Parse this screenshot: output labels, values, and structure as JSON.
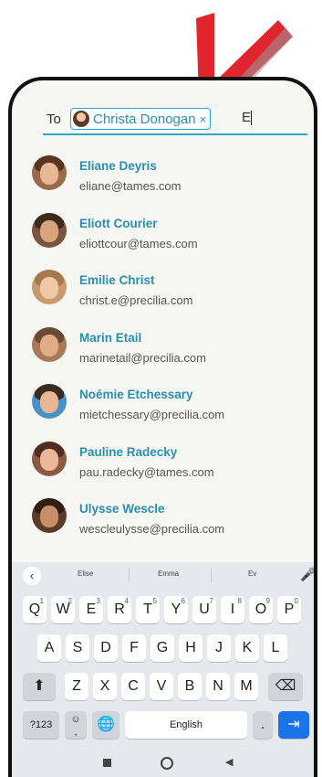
{
  "compose": {
    "to_label": "To",
    "recipient_chip": "Christa Donogan",
    "chip_close": "×",
    "input_value": "E"
  },
  "contacts": [
    {
      "name": "Eliane Deyris",
      "email": "eliane@tames.com"
    },
    {
      "name": "Eliott Courier",
      "email": "eliottcour@tames.com"
    },
    {
      "name": "Emilie Christ",
      "email": "christ.e@precilia.com"
    },
    {
      "name": "Marin Etail",
      "email": "marinetail@precilia.com"
    },
    {
      "name": "Noémie Etchessary",
      "email": "mietchessary@precilia.com"
    },
    {
      "name": "Pauline Radecky",
      "email": "pau.radecky@tames.com"
    },
    {
      "name": "Ulysse Wescle",
      "email": "wescleulysse@precilia.com"
    }
  ],
  "keyboard": {
    "suggestions": [
      "Elise",
      "Emma",
      "Ev"
    ],
    "row1": [
      "Q",
      "W",
      "E",
      "R",
      "T",
      "Y",
      "U",
      "I",
      "O",
      "P"
    ],
    "row1_digits": [
      "1",
      "2",
      "3",
      "4",
      "5",
      "6",
      "7",
      "8",
      "9",
      "0"
    ],
    "row2": [
      "A",
      "S",
      "D",
      "F",
      "G",
      "H",
      "J",
      "K",
      "L"
    ],
    "row3": [
      "Z",
      "X",
      "C",
      "V",
      "B",
      "N",
      "M"
    ],
    "symbols_key": "?123",
    "space_label": "English",
    "period_key": ".",
    "emoji_key": "☺",
    "comma_key": ","
  },
  "colors": {
    "accent": "#2a8fb0",
    "deco_arrow": "#e0252e",
    "enter_key": "#1a73e8"
  },
  "icons": [
    "back-chevron-icon",
    "mic-icon",
    "shift-icon",
    "backspace-icon",
    "globe-icon",
    "enter-icon",
    "nav-recent-icon",
    "nav-home-icon",
    "nav-back-icon"
  ]
}
